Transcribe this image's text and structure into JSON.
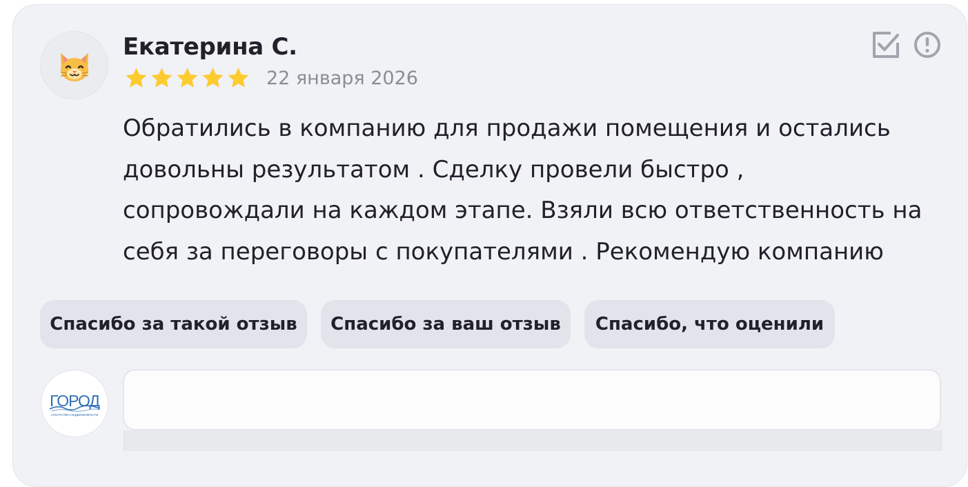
{
  "review": {
    "author": "Екатерина С.",
    "avatar_icon": "cat-face-icon",
    "rating": 5,
    "rating_max": 5,
    "date": "22 января 2026",
    "text": "Обратились в компанию для продажи помещения и остались\nдовольны результатом . Сделку провели быстро ,\nсопровождали на каждом этапе. Взяли всю ответственность на\nсебя за переговоры с покупателями . Рекомендую компанию"
  },
  "actions": {
    "mark_icon": "checkbox-edit-icon",
    "report_icon": "alert-circle-icon"
  },
  "quick_replies": [
    "Спасибо за такой отзыв",
    "Спасибо за ваш отзыв",
    "Спасибо, что оценили"
  ],
  "reply": {
    "company_logo_text": "ГОРОД",
    "company_logo_subtext": "АГЕНТСТВО НЕДВИЖИМОСТИ",
    "value": "",
    "placeholder": ""
  },
  "colors": {
    "card_bg": "#f1f2f6",
    "star": "#fccb30",
    "chip_bg": "#e2e4ec",
    "text": "#21202b",
    "muted": "#8b8d95",
    "icon": "#a2a4ad",
    "logo_blue": "#2f6fb5"
  }
}
